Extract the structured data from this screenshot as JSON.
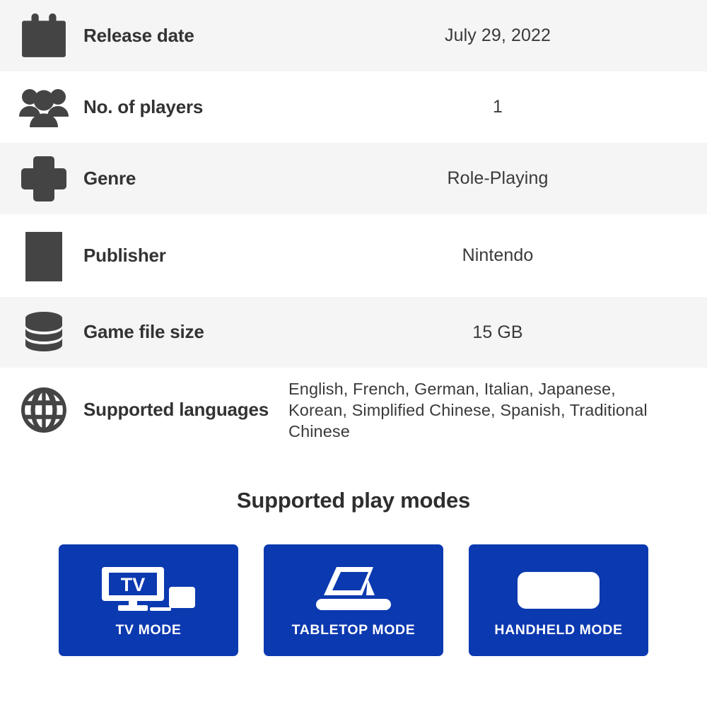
{
  "spec_rows": [
    {
      "icon": "calendar-icon",
      "label": "Release date",
      "value": "July 29, 2022"
    },
    {
      "icon": "players-icon",
      "label": "No. of players",
      "value": "1"
    },
    {
      "icon": "dpad-icon",
      "label": "Genre",
      "value": "Role-Playing"
    },
    {
      "icon": "building-icon",
      "label": "Publisher",
      "value": "Nintendo"
    },
    {
      "icon": "database-icon",
      "label": "Game file size",
      "value": "15 GB"
    },
    {
      "icon": "globe-icon",
      "label": "Supported languages",
      "value": "English, French, German, Italian, Japanese, Korean, Simplified Chinese, Spanish, Traditional Chinese"
    }
  ],
  "play_modes": {
    "title": "Supported play modes",
    "cards": [
      {
        "icon": "tv-mode-icon",
        "label": "TV MODE",
        "screen_text": "TV"
      },
      {
        "icon": "tabletop-mode-icon",
        "label": "TABLETOP MODE"
      },
      {
        "icon": "handheld-mode-icon",
        "label": "HANDHELD MODE"
      }
    ]
  },
  "colors": {
    "card_blue": "#0b39b0",
    "row_alt_background": "#f5f5f5",
    "row_background": "#ffffff",
    "icon_gray": "#444444",
    "label_text": "#333333",
    "value_text": "#3a3a3a"
  }
}
